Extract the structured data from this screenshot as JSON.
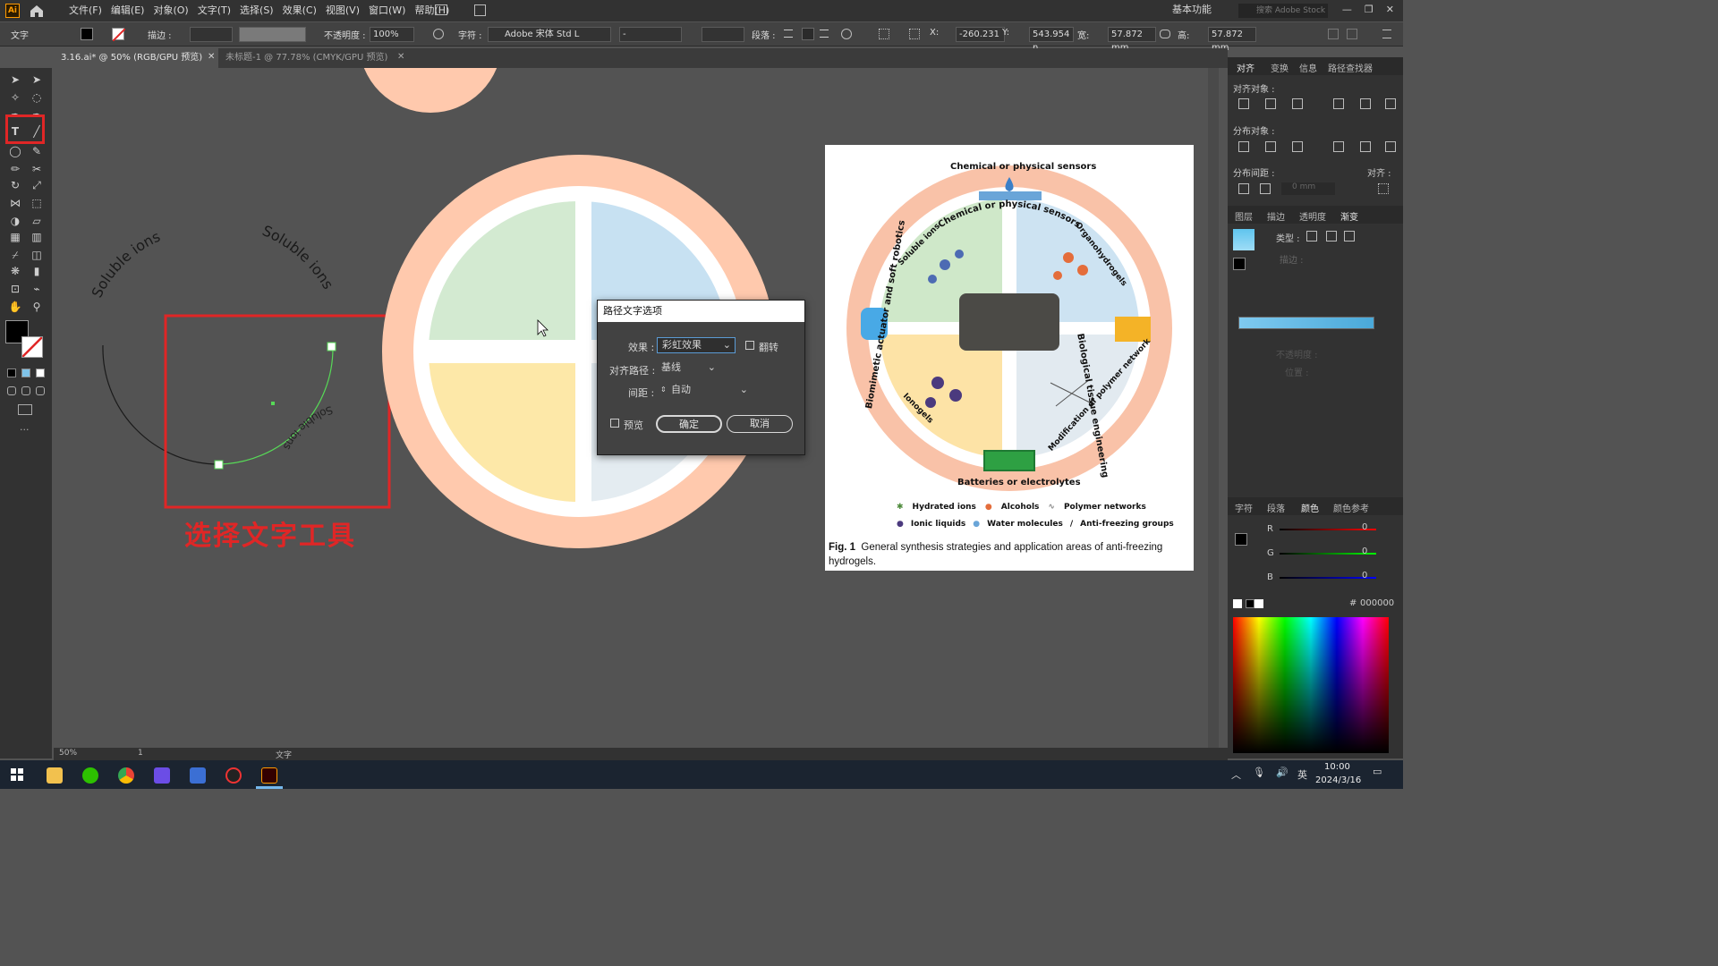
{
  "app": {
    "logo": "Ai",
    "window_title": "基本功能",
    "stock_search": "搜索 Adobe Stock"
  },
  "menu": [
    "文件(F)",
    "编辑(E)",
    "对象(O)",
    "文字(T)",
    "选择(S)",
    "效果(C)",
    "视图(V)",
    "窗口(W)",
    "帮助(H)"
  ],
  "control": {
    "label": "文字",
    "stroke": "描边 :",
    "opacity_label": "不透明度 :",
    "opacity": "100%",
    "char_label": "字符 :",
    "font": "Adobe 宋体 Std L",
    "font_style": "-",
    "para_label": "段落 :",
    "x_label": "X:",
    "x": "-260.231",
    "y_label": "Y:",
    "y": "543.954 n",
    "w_label": "宽:",
    "w": "57.872 mm",
    "h_label": "高:",
    "h": "57.872 mm"
  },
  "tabs": [
    {
      "label": "3.16.ai* @ 50% (RGB/GPU 预览)"
    },
    {
      "label": "未标题-1 @ 77.78% (CMYK/GPU 预览)"
    }
  ],
  "canvas": {
    "path_text_1": "Soluble ions",
    "path_text_2": "Soluble ions",
    "path_text_3": "Soluble ions",
    "annotation": "选择文字工具"
  },
  "dialog": {
    "title": "路径文字选项",
    "effect_label": "效果 :",
    "effect_value": "彩虹效果",
    "flip_label": "翻转",
    "align_label": "对齐路径 :",
    "align_value": "基线",
    "spacing_label": "间距 :",
    "spacing_value": "自动",
    "preview_label": "预览",
    "ok": "确定",
    "cancel": "取消"
  },
  "figure": {
    "top": "Chemical or physical sensors",
    "right": "Biological tissue engineering",
    "bottom": "Batteries or electrolytes",
    "left": "Biomimetic actuator and soft robotics",
    "q1": "Soluble ions",
    "q2": "Organohydrogels",
    "q3": "Ionogels",
    "q4": "Modification of polymer network",
    "legend": [
      "Hydrated ions",
      "Alcohols",
      "Polymer networks",
      "Ionic liquids",
      "Water molecules",
      "Anti-freezing groups"
    ],
    "legend_slash": "/",
    "caption_label": "Fig. 1",
    "caption": "General synthesis strategies and application areas of anti-freezing hydrogels."
  },
  "panel": {
    "tabs1": [
      "对齐",
      "变换",
      "信息",
      "路径查找器"
    ],
    "align_objects": "对齐对象 :",
    "distribute_objects": "分布对象 :",
    "distribute_spacing": "分布间距 :",
    "align_to": "对齐 :",
    "spacing_val": "0 mm",
    "tabs2": [
      "图层",
      "描边",
      "透明度",
      "渐变"
    ],
    "grad_type": "类型 :",
    "grad_stroke": "描边 :",
    "opacity": "不透明度 :",
    "position": "位置 :",
    "tabs3": [
      "字符",
      "段落",
      "颜色",
      "颜色参考"
    ],
    "r": "R",
    "g": "G",
    "b": "B",
    "rv": "0",
    "gv": "0",
    "bv": "0",
    "hash": "#",
    "hex": "000000"
  },
  "status": {
    "zoom": "50%",
    "page": "1",
    "tool": "文字"
  },
  "taskbar": {
    "time": "10:00",
    "date": "2024/3/16",
    "ime": "英"
  },
  "colors": {
    "accent_red": "#e02626",
    "peach": "#ffc9ad",
    "green": "#d3ead1",
    "blue": "#c7e1f2",
    "yellow": "#fde8a8"
  }
}
